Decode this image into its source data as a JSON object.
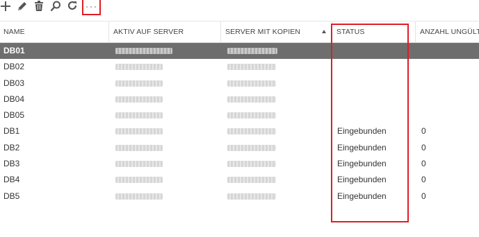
{
  "toolbar": {
    "icons": [
      "add-icon",
      "edit-icon",
      "delete-icon",
      "search-icon",
      "refresh-icon",
      "more-icon"
    ],
    "more_label": "..."
  },
  "table": {
    "columns": [
      "NAME",
      "AKTIV AUF SERVER",
      "SERVER MIT KOPIEN",
      "STATUS",
      "ANZAHL UNGÜLTIG"
    ],
    "sort": {
      "column": "SERVER MIT KOPIEN",
      "direction": "ascending"
    },
    "selected_row": "DB01",
    "rows": [
      {
        "name": "DB01",
        "active_server": "redacted",
        "copies_server": "redacted",
        "status": "",
        "count": ""
      },
      {
        "name": "DB02",
        "active_server": "redacted",
        "copies_server": "redacted",
        "status": "",
        "count": ""
      },
      {
        "name": "DB03",
        "active_server": "redacted",
        "copies_server": "redacted",
        "status": "",
        "count": ""
      },
      {
        "name": "DB04",
        "active_server": "redacted",
        "copies_server": "redacted",
        "status": "",
        "count": ""
      },
      {
        "name": "DB05",
        "active_server": "redacted",
        "copies_server": "redacted",
        "status": "",
        "count": ""
      },
      {
        "name": "DB1",
        "active_server": "redacted",
        "copies_server": "redacted",
        "status": "Eingebunden",
        "count": "0"
      },
      {
        "name": "DB2",
        "active_server": "redacted",
        "copies_server": "redacted",
        "status": "Eingebunden",
        "count": "0"
      },
      {
        "name": "DB3",
        "active_server": "redacted",
        "copies_server": "redacted",
        "status": "Eingebunden",
        "count": "0"
      },
      {
        "name": "DB4",
        "active_server": "redacted",
        "copies_server": "redacted",
        "status": "Eingebunden",
        "count": "0"
      },
      {
        "name": "DB5",
        "active_server": "redacted",
        "copies_server": "redacted",
        "status": "Eingebunden",
        "count": "0"
      }
    ]
  },
  "colors": {
    "selected_row_bg": "#6e6e6e",
    "highlight_red": "#e01b24",
    "icon_gray": "#666666"
  }
}
